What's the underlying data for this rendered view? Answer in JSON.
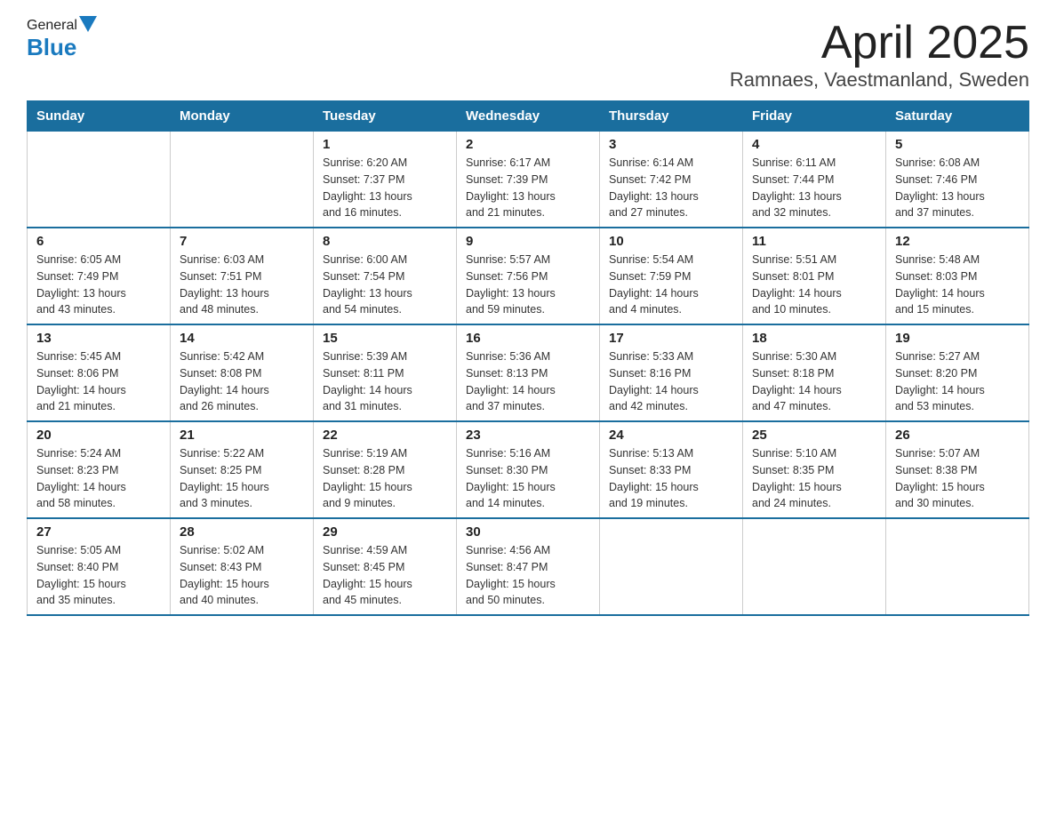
{
  "header": {
    "logo": {
      "general": "General",
      "blue": "Blue"
    },
    "title": "April 2025",
    "subtitle": "Ramnaes, Vaestmanland, Sweden"
  },
  "days_of_week": [
    "Sunday",
    "Monday",
    "Tuesday",
    "Wednesday",
    "Thursday",
    "Friday",
    "Saturday"
  ],
  "weeks": [
    [
      {
        "day": "",
        "info": ""
      },
      {
        "day": "",
        "info": ""
      },
      {
        "day": "1",
        "info": "Sunrise: 6:20 AM\nSunset: 7:37 PM\nDaylight: 13 hours\nand 16 minutes."
      },
      {
        "day": "2",
        "info": "Sunrise: 6:17 AM\nSunset: 7:39 PM\nDaylight: 13 hours\nand 21 minutes."
      },
      {
        "day": "3",
        "info": "Sunrise: 6:14 AM\nSunset: 7:42 PM\nDaylight: 13 hours\nand 27 minutes."
      },
      {
        "day": "4",
        "info": "Sunrise: 6:11 AM\nSunset: 7:44 PM\nDaylight: 13 hours\nand 32 minutes."
      },
      {
        "day": "5",
        "info": "Sunrise: 6:08 AM\nSunset: 7:46 PM\nDaylight: 13 hours\nand 37 minutes."
      }
    ],
    [
      {
        "day": "6",
        "info": "Sunrise: 6:05 AM\nSunset: 7:49 PM\nDaylight: 13 hours\nand 43 minutes."
      },
      {
        "day": "7",
        "info": "Sunrise: 6:03 AM\nSunset: 7:51 PM\nDaylight: 13 hours\nand 48 minutes."
      },
      {
        "day": "8",
        "info": "Sunrise: 6:00 AM\nSunset: 7:54 PM\nDaylight: 13 hours\nand 54 minutes."
      },
      {
        "day": "9",
        "info": "Sunrise: 5:57 AM\nSunset: 7:56 PM\nDaylight: 13 hours\nand 59 minutes."
      },
      {
        "day": "10",
        "info": "Sunrise: 5:54 AM\nSunset: 7:59 PM\nDaylight: 14 hours\nand 4 minutes."
      },
      {
        "day": "11",
        "info": "Sunrise: 5:51 AM\nSunset: 8:01 PM\nDaylight: 14 hours\nand 10 minutes."
      },
      {
        "day": "12",
        "info": "Sunrise: 5:48 AM\nSunset: 8:03 PM\nDaylight: 14 hours\nand 15 minutes."
      }
    ],
    [
      {
        "day": "13",
        "info": "Sunrise: 5:45 AM\nSunset: 8:06 PM\nDaylight: 14 hours\nand 21 minutes."
      },
      {
        "day": "14",
        "info": "Sunrise: 5:42 AM\nSunset: 8:08 PM\nDaylight: 14 hours\nand 26 minutes."
      },
      {
        "day": "15",
        "info": "Sunrise: 5:39 AM\nSunset: 8:11 PM\nDaylight: 14 hours\nand 31 minutes."
      },
      {
        "day": "16",
        "info": "Sunrise: 5:36 AM\nSunset: 8:13 PM\nDaylight: 14 hours\nand 37 minutes."
      },
      {
        "day": "17",
        "info": "Sunrise: 5:33 AM\nSunset: 8:16 PM\nDaylight: 14 hours\nand 42 minutes."
      },
      {
        "day": "18",
        "info": "Sunrise: 5:30 AM\nSunset: 8:18 PM\nDaylight: 14 hours\nand 47 minutes."
      },
      {
        "day": "19",
        "info": "Sunrise: 5:27 AM\nSunset: 8:20 PM\nDaylight: 14 hours\nand 53 minutes."
      }
    ],
    [
      {
        "day": "20",
        "info": "Sunrise: 5:24 AM\nSunset: 8:23 PM\nDaylight: 14 hours\nand 58 minutes."
      },
      {
        "day": "21",
        "info": "Sunrise: 5:22 AM\nSunset: 8:25 PM\nDaylight: 15 hours\nand 3 minutes."
      },
      {
        "day": "22",
        "info": "Sunrise: 5:19 AM\nSunset: 8:28 PM\nDaylight: 15 hours\nand 9 minutes."
      },
      {
        "day": "23",
        "info": "Sunrise: 5:16 AM\nSunset: 8:30 PM\nDaylight: 15 hours\nand 14 minutes."
      },
      {
        "day": "24",
        "info": "Sunrise: 5:13 AM\nSunset: 8:33 PM\nDaylight: 15 hours\nand 19 minutes."
      },
      {
        "day": "25",
        "info": "Sunrise: 5:10 AM\nSunset: 8:35 PM\nDaylight: 15 hours\nand 24 minutes."
      },
      {
        "day": "26",
        "info": "Sunrise: 5:07 AM\nSunset: 8:38 PM\nDaylight: 15 hours\nand 30 minutes."
      }
    ],
    [
      {
        "day": "27",
        "info": "Sunrise: 5:05 AM\nSunset: 8:40 PM\nDaylight: 15 hours\nand 35 minutes."
      },
      {
        "day": "28",
        "info": "Sunrise: 5:02 AM\nSunset: 8:43 PM\nDaylight: 15 hours\nand 40 minutes."
      },
      {
        "day": "29",
        "info": "Sunrise: 4:59 AM\nSunset: 8:45 PM\nDaylight: 15 hours\nand 45 minutes."
      },
      {
        "day": "30",
        "info": "Sunrise: 4:56 AM\nSunset: 8:47 PM\nDaylight: 15 hours\nand 50 minutes."
      },
      {
        "day": "",
        "info": ""
      },
      {
        "day": "",
        "info": ""
      },
      {
        "day": "",
        "info": ""
      }
    ]
  ]
}
